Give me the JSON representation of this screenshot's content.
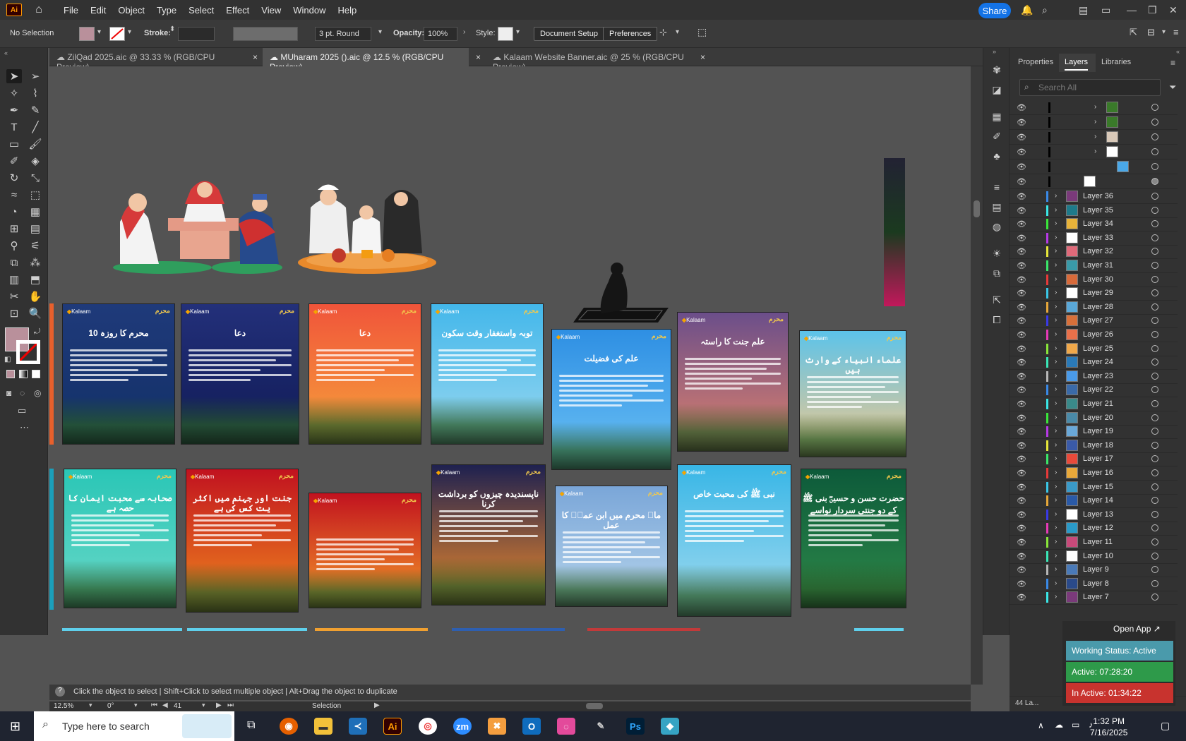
{
  "menubar": {
    "app_icon": "Ai",
    "items": [
      "File",
      "Edit",
      "Object",
      "Type",
      "Select",
      "Effect",
      "View",
      "Window",
      "Help"
    ],
    "share_label": "Share"
  },
  "controlbar": {
    "selection": "No Selection",
    "stroke_label": "Stroke:",
    "brush": "3 pt. Round",
    "opacity_label": "Opacity:",
    "opacity_value": "100%",
    "style_label": "Style:",
    "document_setup": "Document Setup",
    "preferences": "Preferences",
    "fill_color": "#b9909b"
  },
  "tabs": [
    {
      "label": "ZilQad 2025.aic @ 33.33 % (RGB/CPU Preview)"
    },
    {
      "label": "MUharam 2025 ().aic @ 12.5 % (RGB/CPU Preview)"
    },
    {
      "label": "Kalaam Website Banner.aic @ 25 % (RGB/CPU Preview)"
    }
  ],
  "posters_row1": [
    {
      "title": "10 محرم کا روزہ",
      "colors": [
        "#1f3a7a",
        "#123067"
      ]
    },
    {
      "title": "دعا",
      "colors": [
        "#23307a",
        "#101a55"
      ]
    },
    {
      "title": "دعا",
      "colors": [
        "#f0543a",
        "#f7a33b"
      ]
    },
    {
      "title": "توبہ واستغفار وقت سکون",
      "colors": [
        "#43b7ea",
        "#9ad8f0"
      ]
    },
    {
      "title": "علم کی فضیلت",
      "colors": [
        "#2e8fe3",
        "#6cc2f5"
      ]
    },
    {
      "title": "علم جنت کا راستہ",
      "colors": [
        "#6b4e8a",
        "#e0826a"
      ]
    },
    {
      "title": "علماء انبیاء کے وارث ہیں",
      "colors": [
        "#5cc3ea",
        "#f6c98a"
      ]
    }
  ],
  "posters_row2": [
    {
      "title": "صحابہ سے محبت ایمان کا حصہ ہے",
      "colors": [
        "#2ac6b6",
        "#6ad8c8"
      ]
    },
    {
      "title": "جنت اور جہنم میں اکثر یت کس کی ہے",
      "colors": [
        "#c1121f",
        "#f18a1e"
      ]
    },
    {
      "title": "",
      "colors": [
        "#c1121f",
        "#f59a28"
      ]
    },
    {
      "title": "ناپسندیدہ چیزوں کو برداشت کرنا",
      "colors": [
        "#1e2150",
        "#f08a2a"
      ]
    },
    {
      "title": "ماہ محرم میں ابن عمرؓ کا عمل",
      "colors": [
        "#7aa6d8",
        "#b6d4ec"
      ]
    },
    {
      "title": "نبی ﷺ کی محبت خاص",
      "colors": [
        "#38b6e6",
        "#a6dcf0"
      ]
    },
    {
      "title": "حضرت حسن و حسینؓ بنی ﷺ کے دو جنتی سردار نواسے",
      "colors": [
        "#0d5a3a",
        "#2e8a4a"
      ]
    }
  ],
  "poster_brand": "Kalaam",
  "poster_badge": "محرم",
  "panel": {
    "tabs": [
      "Properties",
      "Layers",
      "Libraries"
    ],
    "search_placeholder": "Search All",
    "layers": [
      "Layer 36",
      "Layer 35",
      "Layer 34",
      "Layer 33",
      "Layer 32",
      "Layer 31",
      "Layer 30",
      "Layer 29",
      "Layer 28",
      "Layer 27",
      "Layer 26",
      "Layer 25",
      "Layer 24",
      "Layer 23",
      "Layer 22",
      "Layer 21",
      "Layer 20",
      "Layer 19",
      "Layer 18",
      "Layer 17",
      "Layer 16",
      "Layer 15",
      "Layer 14",
      "Layer 13",
      "Layer 12",
      "Layer 11",
      "Layer 10",
      "Layer 9",
      "Layer 8",
      "Layer 7"
    ],
    "layer_count": "44 La..."
  },
  "widget": {
    "open_app": "Open App",
    "working_status": "Working Status: Active",
    "active": "Active: 07:28:20",
    "inactive": "In Active: 01:34:22"
  },
  "hint": "Click the object to select  |  Shift+Click to select multiple object  |  Alt+Drag the object to duplicate",
  "status": {
    "zoom": "12.5%",
    "rotation": "0°",
    "artboard": "41",
    "tool": "Selection"
  },
  "taskbar": {
    "search_placeholder": "Type here to search",
    "time": "1:32 PM",
    "date": "7/16/2025"
  }
}
